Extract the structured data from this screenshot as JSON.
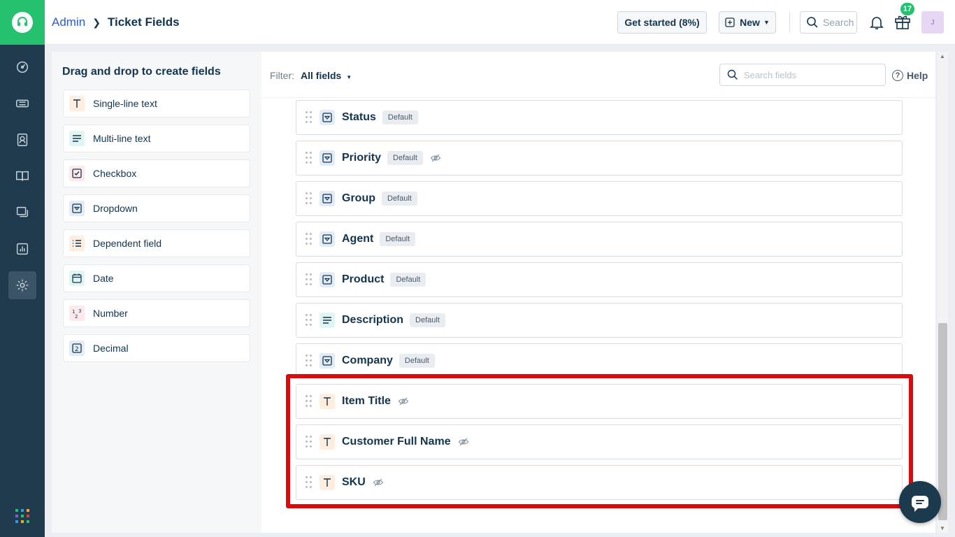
{
  "header": {
    "breadcrumb_root": "Admin",
    "breadcrumb_current": "Ticket Fields",
    "get_started_label": "Get started (8%)",
    "new_label": "New",
    "search_label": "Search",
    "notification_count": "17",
    "avatar_initial": "J"
  },
  "palette": {
    "title": "Drag and drop to create fields",
    "items": [
      {
        "label": "Single-line text",
        "icon": "text-t-icon",
        "bg": "#fdeee0"
      },
      {
        "label": "Multi-line text",
        "icon": "paragraph-icon",
        "bg": "#e0f5f1"
      },
      {
        "label": "Checkbox",
        "icon": "checkbox-icon",
        "bg": "#fde8ec"
      },
      {
        "label": "Dropdown",
        "icon": "dropdown-icon",
        "bg": "#e3ecf6"
      },
      {
        "label": "Dependent field",
        "icon": "list-icon",
        "bg": "#fdeee0"
      },
      {
        "label": "Date",
        "icon": "calendar-icon",
        "bg": "#e0f5f1"
      },
      {
        "label": "Number",
        "icon": "number-icon",
        "bg": "#fde8ec"
      },
      {
        "label": "Decimal",
        "icon": "decimal-icon",
        "bg": "#e3ecf6"
      }
    ]
  },
  "main": {
    "filter_label": "Filter:",
    "filter_value": "All fields",
    "search_placeholder": "Search fields",
    "help_label": "Help",
    "default_tag": "Default",
    "fields": [
      {
        "name": "Status",
        "icon": "dropdown-icon",
        "default": true,
        "hidden": false
      },
      {
        "name": "Priority",
        "icon": "dropdown-icon",
        "default": true,
        "hidden": true
      },
      {
        "name": "Group",
        "icon": "dropdown-icon",
        "default": true,
        "hidden": false
      },
      {
        "name": "Agent",
        "icon": "dropdown-icon",
        "default": true,
        "hidden": false
      },
      {
        "name": "Product",
        "icon": "dropdown-icon",
        "default": true,
        "hidden": false
      },
      {
        "name": "Description",
        "icon": "paragraph-icon",
        "default": true,
        "hidden": false
      },
      {
        "name": "Company",
        "icon": "dropdown-icon",
        "default": true,
        "hidden": false
      },
      {
        "name": "Item Title",
        "icon": "text-t-icon",
        "default": false,
        "hidden": true
      },
      {
        "name": "Customer Full Name",
        "icon": "text-t-icon",
        "default": false,
        "hidden": true
      },
      {
        "name": "SKU",
        "icon": "text-t-icon",
        "default": false,
        "hidden": true
      }
    ]
  },
  "colors": {
    "brand_green": "#25c16f",
    "sidebar": "#1f3b4d",
    "highlight_red": "#d90a10",
    "link_blue": "#2c5cc5"
  }
}
